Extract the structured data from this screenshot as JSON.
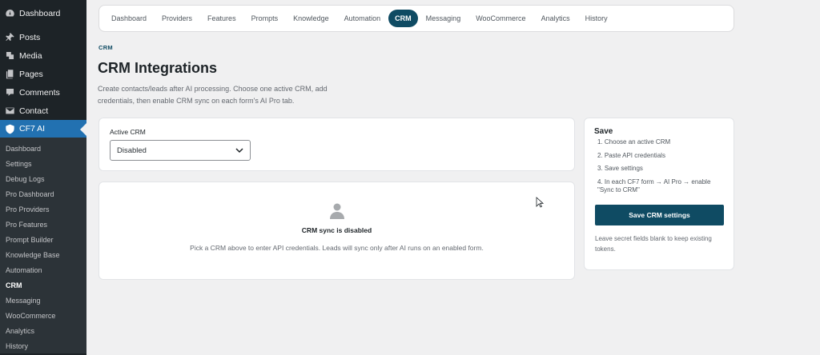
{
  "sidebar": {
    "top_items": [
      {
        "label": "Dashboard",
        "icon": "dashboard-icon"
      },
      {
        "label": "Posts",
        "icon": "pin-icon"
      },
      {
        "label": "Media",
        "icon": "media-icon"
      },
      {
        "label": "Pages",
        "icon": "pages-icon"
      },
      {
        "label": "Comments",
        "icon": "comment-icon"
      },
      {
        "label": "Contact",
        "icon": "mail-icon"
      },
      {
        "label": "CF7 AI",
        "icon": "shield-icon"
      }
    ],
    "sub_items": [
      "Dashboard",
      "Settings",
      "Debug Logs",
      "Pro Dashboard",
      "Pro Providers",
      "Pro Features",
      "Prompt Builder",
      "Knowledge Base",
      "Automation",
      "CRM",
      "Messaging",
      "WooCommerce",
      "Analytics",
      "History"
    ]
  },
  "tabs": [
    "Dashboard",
    "Providers",
    "Features",
    "Prompts",
    "Knowledge",
    "Automation",
    "CRM",
    "Messaging",
    "WooCommerce",
    "Analytics",
    "History"
  ],
  "header": {
    "eyebrow": "CRM",
    "title": "CRM Integrations",
    "description": "Create contacts/leads after AI processing. Choose one active CRM, add credentials, then enable CRM sync on each form's AI Pro tab."
  },
  "crm_card": {
    "label": "Active CRM",
    "selected": "Disabled"
  },
  "status_card": {
    "title": "CRM sync is disabled",
    "description": "Pick a CRM above to enter API credentials. Leads will sync only after AI runs on an enabled form."
  },
  "save_card": {
    "title": "Save",
    "steps": [
      "1. Choose an active CRM",
      "2. Paste API credentials",
      "3. Save settings",
      "4. In each CF7 form → AI Pro → enable \"Sync to CRM\""
    ],
    "button": "Save CRM settings",
    "note": "Leave secret fields blank to keep existing tokens."
  },
  "colors": {
    "accent": "#0f4b63",
    "sidebar_bg": "#1d2327",
    "sidebar_active": "#2271b1"
  }
}
